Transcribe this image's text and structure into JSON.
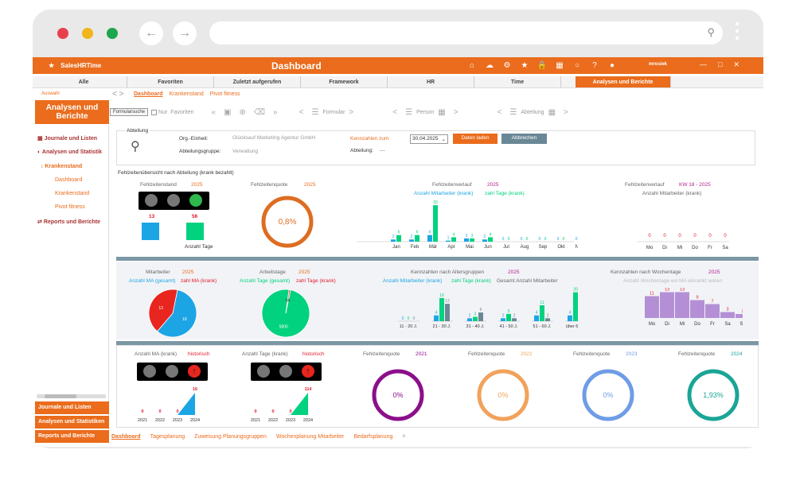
{
  "browser": {
    "search_icon": "search-icon"
  },
  "app": {
    "brand": "SalesHRTime",
    "title": "Dashboard",
    "user": "mrosiek"
  },
  "menu": [
    "Alle",
    "Favoriten",
    "Zuletzt aufgerufen",
    "Framework",
    "HR",
    "Time",
    "Analysen und Berichte"
  ],
  "crumb": "Auswahl",
  "subtabs": [
    "Dashboard",
    "Krankenstand",
    "Pivot fitness"
  ],
  "sidebar": {
    "title": "Analysen und Berichte",
    "items": [
      "Journale und Listen",
      "Analysen und Statistik",
      "Krankenstand",
      "Dashboard",
      "Krankenstand",
      "Pivot fitness",
      "Reports und Berichte"
    ],
    "footer": [
      "Journale und Listen",
      "Analysen und Statistiken",
      "Reports und Berichte"
    ]
  },
  "toolbar": {
    "search_btn": "Formularsuche",
    "nur_label": "Nur",
    "favoriten": "Favoriten",
    "formular": "Formular",
    "person": "Person",
    "abteilung": "Abteilung"
  },
  "filter": {
    "title": "Abteilung",
    "org_label": "Org.-Einheit:",
    "org_value": "Glücksauf Marketing Agentur GmbH",
    "group_label": "Abteilungsgruppe:",
    "group_value": "Verwaltung",
    "kz_label": "Kennzahlen zum",
    "date": "30.04.2025",
    "abt_label": "Abteilung:",
    "abt_value": "---",
    "load": "Daten laden",
    "cancel": "Abbrechen"
  },
  "overview_title": "Fehlzeitenübersicht nach Abteilung (krank bezahlt)",
  "row1": {
    "stand": {
      "title": "Fehlzeitenstand",
      "year": "2025",
      "v1": "13",
      "v2": "56",
      "label": "Anzahl Tage"
    },
    "quote": {
      "title": "Fehlzeitenquote",
      "year": "2025",
      "value": "0,8%",
      "pct": 0.8
    },
    "verlauf": {
      "title": "Fehlzeitenverlauf",
      "year": "2025",
      "legend1": "Anzahl Mitarbeiter (krank)",
      "legend2": "zahl Tage (krank)"
    },
    "kw": {
      "title": "Fehlzeitenverlauf",
      "range": "KW 18 - 2025",
      "sub": "Anzahl Mitarbeiter (krank)"
    }
  },
  "row2": {
    "ma": {
      "title": "Mitarbeiter",
      "year": "2025",
      "leg1": "Anzahl MA (gesamt)",
      "leg2": "zahl MA (krank)",
      "a": "13",
      "b": "18"
    },
    "at": {
      "title": "Arbeitstage",
      "year": "2025",
      "leg1": "Anzahl Tage (gesamt)",
      "leg2": "zahl Tage (krank)",
      "a": "5800",
      "b": "56"
    },
    "alter": {
      "title": "Kennzahlen nach Altersgruppen",
      "year": "2025",
      "leg1": "Anzahl Mitarbeiter (krank)",
      "leg2": "zahl Tage (krank)",
      "leg3": "Gesamt Anzahl Mitarbeiter"
    },
    "wt": {
      "title": "Kennzahlen nach Wochentage",
      "year": "2025",
      "sub": "Anzahl Wochentage wo MA erkrankt waren"
    }
  },
  "row3": {
    "hist1": {
      "title": "Anzahl MA (krank)",
      "tag": "historisch"
    },
    "hist2": {
      "title": "Anzahl Tage (krank)",
      "tag": "historisch"
    },
    "q": [
      {
        "title": "Fehlzeitenquote",
        "year": "2021",
        "value": "0%",
        "pct": 0,
        "color": "#8b0f8a"
      },
      {
        "title": "Fehlzeitenquote",
        "year": "2022",
        "value": "0%",
        "pct": 0,
        "color": "#f2a25c"
      },
      {
        "title": "Fehlzeitenquote",
        "year": "2023",
        "value": "0%",
        "pct": 0,
        "color": "#6f9ce6"
      },
      {
        "title": "Fehlzeitenquote",
        "year": "2024",
        "value": "1,93%",
        "pct": 1.93,
        "color": "#1aa596"
      }
    ]
  },
  "bottomtabs": [
    "Dashboard",
    "Tagesplanung",
    "Zuweisung Planungsgruppen",
    "Wochenplanung Mitarbeiter",
    "Bedarfsplanung"
  ],
  "chart_data": [
    {
      "type": "bar",
      "title": "Fehlzeitenverlauf 2025",
      "categories": [
        "Jan",
        "Feb",
        "Mär",
        "Apr",
        "Mai",
        "Jun",
        "Jul",
        "Aug",
        "Sep",
        "Okt",
        "Nov",
        "Dez"
      ],
      "series": [
        {
          "name": "Anzahl Mitarbeiter (krank)",
          "values": [
            2,
            2,
            6,
            1,
            3,
            2,
            0,
            0,
            0,
            0,
            0,
            0
          ]
        },
        {
          "name": "zahl Tage (krank)",
          "values": [
            6,
            6,
            33,
            4,
            3,
            4,
            0,
            0,
            0,
            0,
            0,
            0
          ]
        }
      ],
      "ylim": [
        0,
        36
      ]
    },
    {
      "type": "bar",
      "title": "Fehlzeitenverlauf KW 18 - 2025",
      "categories": [
        "Mo",
        "Di",
        "Mi",
        "Do",
        "Fr",
        "Sa",
        "So"
      ],
      "values": [
        0,
        0,
        0,
        0,
        0,
        0,
        0
      ],
      "ylim": [
        0,
        10
      ]
    },
    {
      "type": "pie",
      "title": "Mitarbeiter 2025",
      "labels": [
        "Anzahl MA (gesamt)",
        "zahl MA (krank)"
      ],
      "values": [
        18,
        13
      ]
    },
    {
      "type": "pie",
      "title": "Arbeitstage 2025",
      "labels": [
        "Anzahl Tage (gesamt)",
        "zahl Tage (krank)"
      ],
      "values": [
        5800,
        56
      ]
    },
    {
      "type": "bar",
      "title": "Kennzahlen nach Altersgruppen 2025",
      "categories": [
        "11 - 20 J.",
        "21 - 30 J.",
        "31 - 40 J.",
        "41 - 50 J.",
        "51 - 60 J.",
        "über 60 J."
      ],
      "series": [
        {
          "name": "Anzahl Mitarbeiter (krank)",
          "values": [
            0,
            4,
            2,
            2,
            4,
            4
          ]
        },
        {
          "name": "zahl Tage (krank)",
          "values": [
            0,
            16,
            3,
            5,
            11,
            20
          ]
        },
        {
          "name": "Gesamt Anzahl Mitarbeiter",
          "values": [
            0,
            12,
            6,
            2,
            2,
            4
          ]
        }
      ],
      "ylim": [
        0,
        22
      ]
    },
    {
      "type": "bar",
      "title": "Kennzahlen nach Wochentage 2025",
      "categories": [
        "Mo",
        "Di",
        "Mi",
        "Do",
        "Fr",
        "Sa",
        "So"
      ],
      "values": [
        11,
        13,
        13,
        9,
        7,
        3,
        2
      ],
      "ylim": [
        0,
        14
      ]
    },
    {
      "type": "area",
      "title": "Anzahl MA (krank) historisch",
      "categories": [
        "2021",
        "2022",
        "2023",
        "2024"
      ],
      "values": [
        0,
        0,
        0,
        16
      ]
    },
    {
      "type": "area",
      "title": "Anzahl Tage (krank) historisch",
      "categories": [
        "2021",
        "2022",
        "2023",
        "2024"
      ],
      "values": [
        0,
        0,
        0,
        114
      ]
    }
  ]
}
